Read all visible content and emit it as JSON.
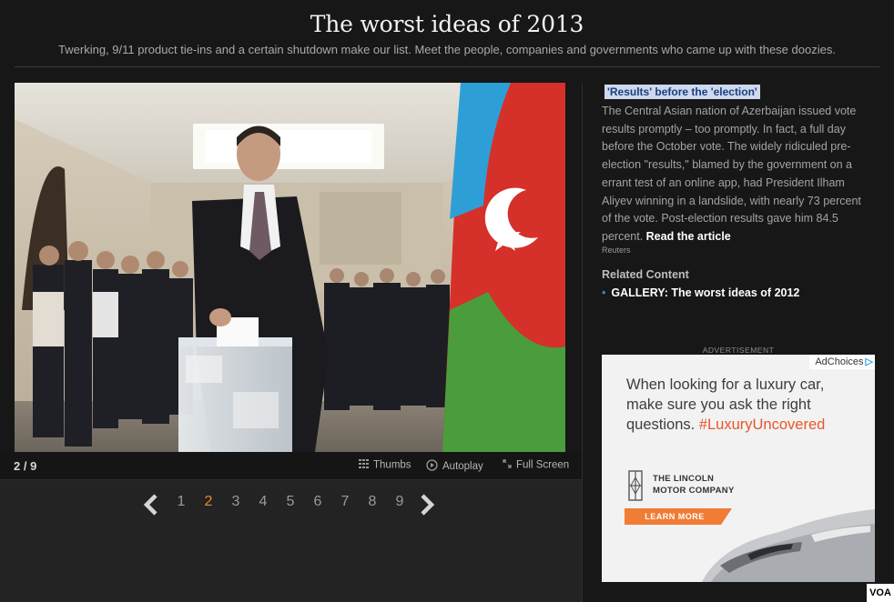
{
  "header": {
    "title": "The worst ideas of 2013",
    "subtitle": "Twerking, 9/11 product tie-ins and a certain shutdown make our list. Meet the people, companies and governments who came up with these doozies."
  },
  "slideshow": {
    "counter": "2 / 9",
    "controls": {
      "thumbs": "Thumbs",
      "autoplay": "Autoplay",
      "fullscreen": "Full Screen"
    },
    "pages": [
      "1",
      "2",
      "3",
      "4",
      "5",
      "6",
      "7",
      "8",
      "9"
    ],
    "active_page": "2"
  },
  "caption": {
    "title": "'Results' before the 'election'",
    "body": "The Central Asian nation of Azerbaijan issued vote results promptly – too promptly. In fact, a full day before the October vote. The widely ridiculed pre-election \"results,\" blamed by the government on a errant test of an online app, had President Ilham Aliyev winning in a landslide, with nearly 73 percent of the vote. Post-election results gave him 84.5 percent.",
    "read_more": "Read the article",
    "credit": "Reuters"
  },
  "related": {
    "heading": "Related Content",
    "items": [
      "GALLERY: The worst ideas of 2012"
    ]
  },
  "ad": {
    "label": "ADVERTISEMENT",
    "adchoices": "AdChoices",
    "line1": "When looking for a luxury car, make sure you ask the right questions.",
    "hashtag": "#LuxuryUncovered",
    "brand_line1": "THE LINCOLN",
    "brand_line2": "MOTOR COMPANY",
    "cta": "LEARN MORE"
  },
  "watermark": "VOA",
  "colors": {
    "background": "#171717",
    "active_page": "#e98a2c",
    "caption_title_bg": "#cfd9ee",
    "caption_title_text": "#1a3f80",
    "ad_hashtag": "#e9562b",
    "ad_cta": "#f07c35"
  },
  "icons": {
    "prev": "chevron-left-icon",
    "next": "chevron-right-icon",
    "thumbs": "grid-icon",
    "autoplay": "play-circle-icon",
    "fullscreen": "expand-icon",
    "adchoices": "adchoices-triangle-icon"
  }
}
